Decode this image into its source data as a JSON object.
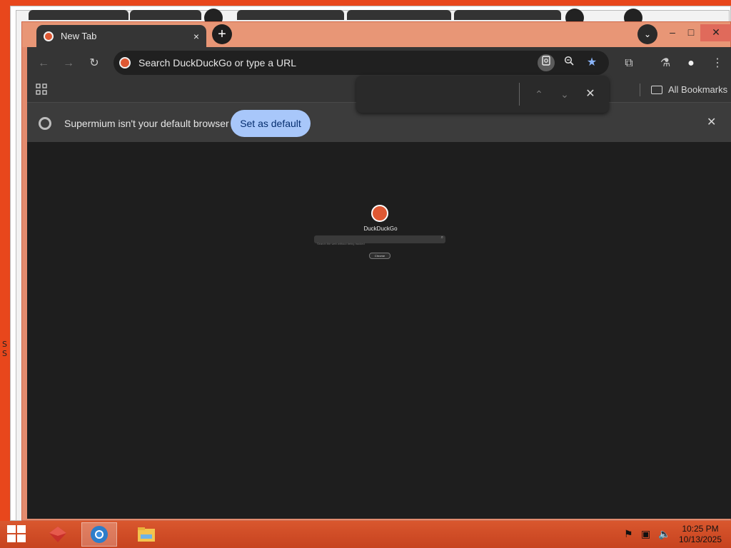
{
  "browser": {
    "tab": {
      "title": "New Tab",
      "close_glyph": "×"
    },
    "new_tab_glyph": "+",
    "tab_search_glyph": "⌄",
    "window_controls": {
      "minimize": "–",
      "maximize": "□",
      "close": "✕"
    },
    "toolbar": {
      "back": "←",
      "forward": "→",
      "reload": "↻",
      "omnibox_placeholder": "Search DuckDuckGo or type a URL",
      "extensions": "⧉",
      "labs": "⚗",
      "profile": "●",
      "menu": "⋮"
    },
    "bookmarks_bar": {
      "all_bookmarks": "All Bookmarks"
    },
    "find_bar": {
      "value": "",
      "prev": "⌃",
      "next": "⌄",
      "close": "✕"
    },
    "infobar": {
      "message": "Supermium isn't your default browser",
      "button": "Set as default",
      "close": "✕"
    },
    "page": {
      "brand": "DuckDuckGo",
      "search_placeholder": "Search the web without being tracked",
      "cta": "Chrome"
    }
  },
  "taskbar": {
    "clock_time": "10:25 PM",
    "clock_date": "10/13/2025",
    "apps": [
      "app-red-icon",
      "browser-icon",
      "file-explorer-icon"
    ]
  },
  "colors": {
    "desktop": "#e8471c",
    "titlebar": "#e89676",
    "toolbar": "#353535",
    "content": "#1e1e1e",
    "accent": "#a8c7fa"
  }
}
